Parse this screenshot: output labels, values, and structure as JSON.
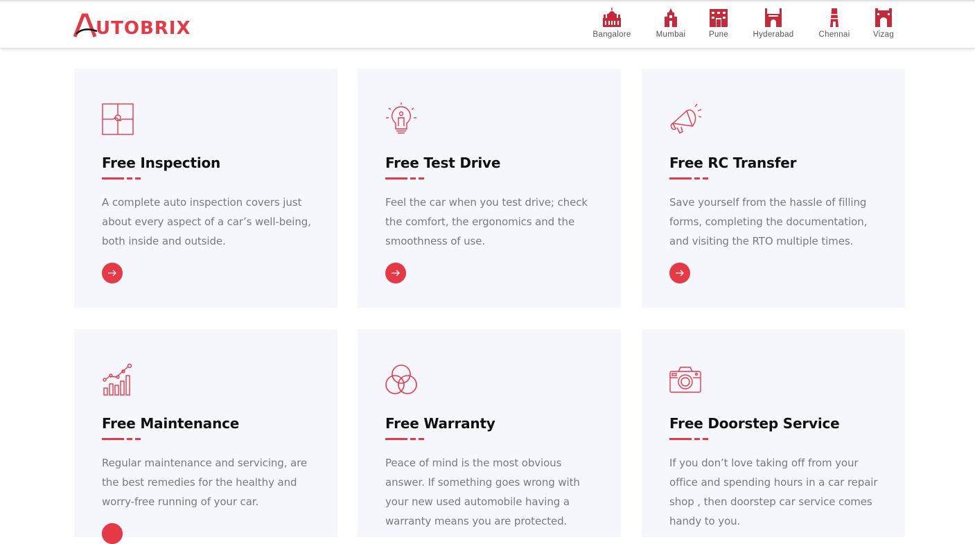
{
  "brand": {
    "name": "UTOBRIX",
    "accent": "#e63946"
  },
  "cities": [
    {
      "label": "Bangalore",
      "icon": "bangalore-palace-icon"
    },
    {
      "label": "Mumbai",
      "icon": "mumbai-building-icon"
    },
    {
      "label": "Pune",
      "icon": "pune-fort-icon"
    },
    {
      "label": "Hyderabad",
      "icon": "charminar-icon"
    },
    {
      "label": "Chennai",
      "icon": "chennai-temple-icon"
    },
    {
      "label": "Vizag",
      "icon": "vizag-building-icon"
    }
  ],
  "services": [
    {
      "title": "Free Inspection",
      "text": "A complete auto inspection covers just about every aspect of a car’s well-being, both inside and outside.",
      "icon": "puzzle-icon"
    },
    {
      "title": "Free Test Drive",
      "text": "Feel the car when you test drive; check the comfort, the ergonomics and the smoothness of use.",
      "icon": "lightbulb-icon"
    },
    {
      "title": "Free RC Transfer",
      "text": "Save yourself from the hassle of filling forms, completing the documentation, and visiting the RTO multiple times.",
      "icon": "megaphone-icon"
    },
    {
      "title": "Free Maintenance",
      "text": "Regular maintenance and servicing, are the best remedies for the healthy and worry-free running of your car.",
      "icon": "growth-chart-icon"
    },
    {
      "title": "Free Warranty",
      "text": "Peace of mind is the most obvious answer. If something goes wrong with your new used automobile having a warranty means you are protected.",
      "icon": "three-circles-icon"
    },
    {
      "title": "Free Doorstep Service",
      "text": "If you don’t love taking off from your office and spending hours in a car repair shop , then doorstep car service comes handy to you.",
      "icon": "camera-icon"
    }
  ]
}
